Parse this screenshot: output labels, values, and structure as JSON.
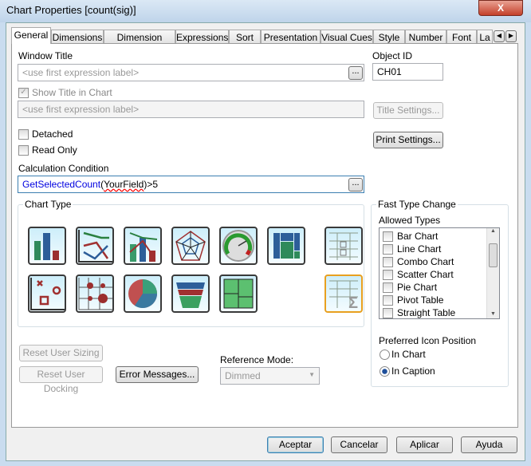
{
  "window": {
    "title": "Chart Properties [count(sig)]",
    "close": "X"
  },
  "tabs": [
    "General",
    "Dimensions",
    "Dimension Limits",
    "Expressions",
    "Sort",
    "Presentation",
    "Visual Cues",
    "Style",
    "Number",
    "Font",
    "La"
  ],
  "general": {
    "window_title_label": "Window Title",
    "window_title_placeholder": "<use first expression label>",
    "object_id_label": "Object ID",
    "object_id": "CH01",
    "show_title_label": "Show Title in Chart",
    "show_title_checked": true,
    "chart_title_placeholder": "<use first expression label>",
    "title_settings": "Title Settings...",
    "print_settings": "Print Settings...",
    "detached_label": "Detached",
    "read_only_label": "Read Only",
    "calc_condition_label": "Calculation Condition",
    "calc_condition": {
      "func": "GetSelectedCount",
      "arg": "YourField",
      "rest": ">5"
    },
    "ellipsis": "...",
    "chart_type_label": "Chart Type",
    "chart_types": [
      "bar-chart",
      "line-chart",
      "combo-chart",
      "radar-chart",
      "gauge-chart",
      "block-chart",
      "pivot-table",
      "scatter-chart",
      "grid-chart",
      "pie-chart",
      "funnel-chart",
      "mekko-chart",
      "straight-table"
    ],
    "selected_chart_type": "straight-table",
    "fast_type_label": "Fast Type Change",
    "allowed_types_label": "Allowed Types",
    "allowed_types": [
      "Bar Chart",
      "Line Chart",
      "Combo Chart",
      "Scatter Chart",
      "Pie Chart",
      "Pivot Table",
      "Straight Table"
    ],
    "icon_position_label": "Preferred Icon Position",
    "icon_positions": [
      "In Chart",
      "In Caption"
    ],
    "icon_position_selected": "In Caption",
    "reset_sizing": "Reset User Sizing",
    "reset_docking": "Reset User Docking",
    "error_messages": "Error Messages...",
    "reference_mode_label": "Reference Mode:",
    "reference_mode": "Dimmed"
  },
  "footer": {
    "ok": "Aceptar",
    "cancel": "Cancelar",
    "apply": "Aplicar",
    "help": "Ayuda"
  }
}
